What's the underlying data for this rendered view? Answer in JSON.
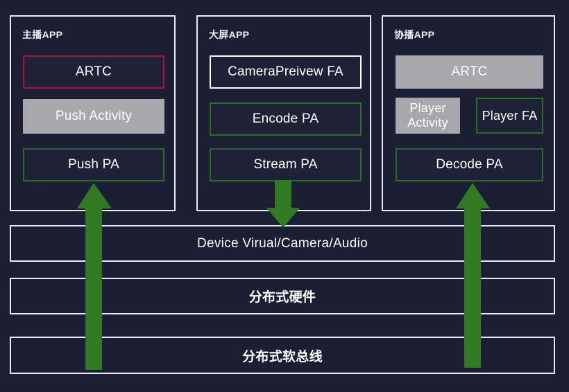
{
  "theme": {
    "background": "#1a1f33",
    "box_fill": "#1d2236",
    "border_white": "#e8eaf2",
    "border_red": "#b0123c",
    "border_green": "#2f6b26",
    "fill_gray": "#a8a8ac",
    "arrow_green": "#317a23",
    "text": "#ffffff"
  },
  "panels": [
    {
      "id": "host-app",
      "title": "主播APP",
      "boxes": [
        {
          "label": "ARTC",
          "style": "red"
        },
        {
          "label": "Push Activity",
          "style": "gray"
        },
        {
          "label": "Push PA",
          "style": "green"
        }
      ]
    },
    {
      "id": "bigscreen-app",
      "title": "大屏APP",
      "boxes": [
        {
          "label": "CameraPreivew FA",
          "style": "white"
        },
        {
          "label": "Encode PA",
          "style": "green"
        },
        {
          "label": "Stream PA",
          "style": "green"
        }
      ]
    },
    {
      "id": "cohost-app",
      "title": "协播APP",
      "boxes": [
        {
          "label": "ARTC",
          "style": "gray"
        },
        {
          "label": "Player Activity",
          "style": "gray"
        },
        {
          "label": "Player FA",
          "style": "green"
        },
        {
          "label": "Decode PA",
          "style": "green"
        }
      ]
    }
  ],
  "layers": [
    {
      "id": "device-virtual",
      "label": "Device Virual/Camera/Audio"
    },
    {
      "id": "distributed-hardware",
      "label": "分布式硬件"
    },
    {
      "id": "distributed-softbus",
      "label": "分布式软总线"
    }
  ],
  "arrows": [
    {
      "id": "host-up-arrow",
      "direction": "up"
    },
    {
      "id": "bigscreen-down-arrow",
      "direction": "down"
    },
    {
      "id": "cohost-up-arrow",
      "direction": "up"
    }
  ]
}
